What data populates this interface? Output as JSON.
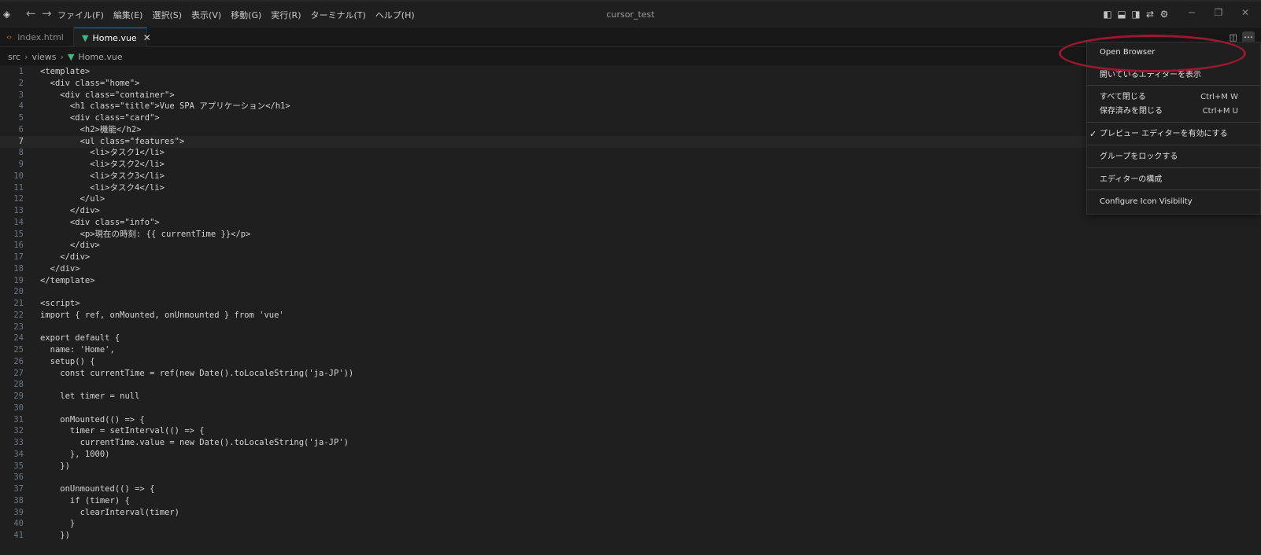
{
  "window": {
    "title": "cursor_test",
    "menu": [
      "ファイル(F)",
      "編集(E)",
      "選択(S)",
      "表示(V)",
      "移動(G)",
      "実行(R)",
      "ターミナル(T)",
      "ヘルプ(H)"
    ]
  },
  "tabs": [
    {
      "label": "index.html",
      "active": false,
      "icon": "html-file-icon"
    },
    {
      "label": "Home.vue",
      "active": true,
      "icon": "vue-file-icon",
      "close": "✕"
    }
  ],
  "breadcrumb": [
    "src",
    "views",
    "Home.vue"
  ],
  "editor": {
    "current_line": 7,
    "lines": [
      {
        "n": 1,
        "text": "<template>"
      },
      {
        "n": 2,
        "text": "  <div class=\"home\">"
      },
      {
        "n": 3,
        "text": "    <div class=\"container\">"
      },
      {
        "n": 4,
        "text": "      <h1 class=\"title\">Vue SPA アプリケーション</h1>"
      },
      {
        "n": 5,
        "text": "      <div class=\"card\">"
      },
      {
        "n": 6,
        "text": "        <h2>機能</h2>"
      },
      {
        "n": 7,
        "text": "        <ul class=\"features\">"
      },
      {
        "n": 8,
        "text": "          <li>タスク1</li>"
      },
      {
        "n": 9,
        "text": "          <li>タスク2</li>"
      },
      {
        "n": 10,
        "text": "          <li>タスク3</li>"
      },
      {
        "n": 11,
        "text": "          <li>タスク4</li>"
      },
      {
        "n": 12,
        "text": "        </ul>"
      },
      {
        "n": 13,
        "text": "      </div>"
      },
      {
        "n": 14,
        "text": "      <div class=\"info\">"
      },
      {
        "n": 15,
        "text": "        <p>現在の時刻: {{ currentTime }}</p>"
      },
      {
        "n": 16,
        "text": "      </div>"
      },
      {
        "n": 17,
        "text": "    </div>"
      },
      {
        "n": 18,
        "text": "  </div>"
      },
      {
        "n": 19,
        "text": "</template>"
      },
      {
        "n": 20,
        "text": ""
      },
      {
        "n": 21,
        "text": "<script>"
      },
      {
        "n": 22,
        "text": "import { ref, onMounted, onUnmounted } from 'vue'"
      },
      {
        "n": 23,
        "text": ""
      },
      {
        "n": 24,
        "text": "export default {"
      },
      {
        "n": 25,
        "text": "  name: 'Home',"
      },
      {
        "n": 26,
        "text": "  setup() {"
      },
      {
        "n": 27,
        "text": "    const currentTime = ref(new Date().toLocaleString('ja-JP'))"
      },
      {
        "n": 28,
        "text": ""
      },
      {
        "n": 29,
        "text": "    let timer = null"
      },
      {
        "n": 30,
        "text": ""
      },
      {
        "n": 31,
        "text": "    onMounted(() => {"
      },
      {
        "n": 32,
        "text": "      timer = setInterval(() => {"
      },
      {
        "n": 33,
        "text": "        currentTime.value = new Date().toLocaleString('ja-JP')"
      },
      {
        "n": 34,
        "text": "      }, 1000)"
      },
      {
        "n": 35,
        "text": "    })"
      },
      {
        "n": 36,
        "text": ""
      },
      {
        "n": 37,
        "text": "    onUnmounted(() => {"
      },
      {
        "n": 38,
        "text": "      if (timer) {"
      },
      {
        "n": 39,
        "text": "        clearInterval(timer)"
      },
      {
        "n": 40,
        "text": "      }"
      },
      {
        "n": 41,
        "text": "    })"
      }
    ]
  },
  "context_menu": {
    "groups": [
      [
        {
          "label": "Open Browser",
          "shortcut": ""
        },
        {
          "label": "開いているエディターを表示",
          "shortcut": ""
        }
      ],
      [
        {
          "label": "すべて閉じる",
          "shortcut": "Ctrl+M W"
        },
        {
          "label": "保存済みを閉じる",
          "shortcut": "Ctrl+M U"
        }
      ],
      [
        {
          "label": "プレビュー エディターを有効にする",
          "shortcut": "",
          "checked": true
        }
      ],
      [
        {
          "label": "グループをロックする",
          "shortcut": ""
        }
      ],
      [
        {
          "label": "エディターの構成",
          "shortcut": ""
        }
      ],
      [
        {
          "label": "Configure Icon Visibility",
          "shortcut": ""
        }
      ]
    ],
    "check_glyph": "✓"
  },
  "colors": {
    "accent": "#0078d4",
    "vue_green": "#41b883",
    "html_orange": "#e37933",
    "annotation_red": "#9b1830"
  }
}
